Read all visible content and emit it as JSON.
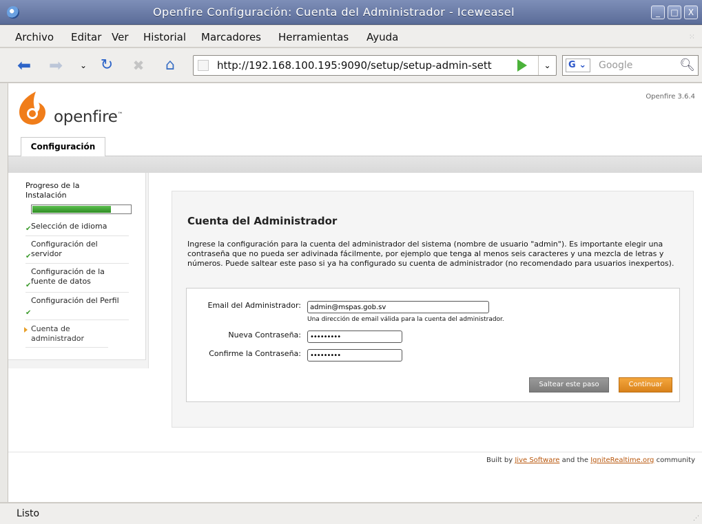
{
  "window": {
    "title": "Openfire Configuración: Cuenta del Administrador - Iceweasel",
    "buttons": {
      "minimize": "_",
      "maximize": "□",
      "close": "X"
    }
  },
  "menubar": {
    "items": [
      "Archivo",
      "Editar",
      "Ver",
      "Historial",
      "Marcadores",
      "Herramientas",
      "Ayuda"
    ]
  },
  "navbar": {
    "url": "http://192.168.100.195:9090/setup/setup-admin-sett",
    "search_placeholder": "Google",
    "search_engine": "G",
    "icons": [
      "back-arrow-icon",
      "forward-arrow-icon",
      "history-dropdown-icon",
      "reload-icon",
      "stop-icon",
      "home-icon"
    ]
  },
  "header": {
    "logo_text": "openfire",
    "logo_tm": "™",
    "version": "Openfire 3.6.4",
    "tab_label": "Configuración"
  },
  "sidebar": {
    "title": "Progreso de la Instalación",
    "progress": 0.8,
    "steps": [
      {
        "label": "Selección de idioma",
        "done": true
      },
      {
        "label": "Configuración del servidor",
        "done": true
      },
      {
        "label": "Configuración de la fuente de datos",
        "done": true
      },
      {
        "label": "Configuración del Perfil",
        "done": true
      },
      {
        "label": "Cuenta de administrador",
        "done": false,
        "current": true
      }
    ]
  },
  "main": {
    "heading": "Cuenta del Administrador",
    "description": "Ingrese la configuración para la cuenta del administrador del sistema (nombre de usuario \"admin\"). Es importante elegir una contraseña que no pueda ser adivinada fácilmente, por ejemplo que tenga al menos seis caracteres y una mezcla de letras y números. Puede saltear este paso si ya ha configurado su cuenta de administrador (no recomendado para usuarios inexpertos).",
    "form": {
      "email_label": "Email del Administrador:",
      "email_value": "admin@mspas.gob.sv",
      "email_hint": "Una dirección de email válida para la cuenta del administrador.",
      "password_label": "Nueva Contraseña:",
      "password_value": "•••••••••",
      "confirm_label": "Confirme la Contraseña:",
      "confirm_value": "•••••••••",
      "skip_button": "Saltear este paso",
      "continue_button": "Continuar"
    }
  },
  "footer": {
    "prefix": "Built by",
    "link1": "Jive Software",
    "middle": "and the",
    "link2": "IgniteRealtime.org",
    "suffix": "community"
  },
  "status": {
    "text": "Listo"
  }
}
